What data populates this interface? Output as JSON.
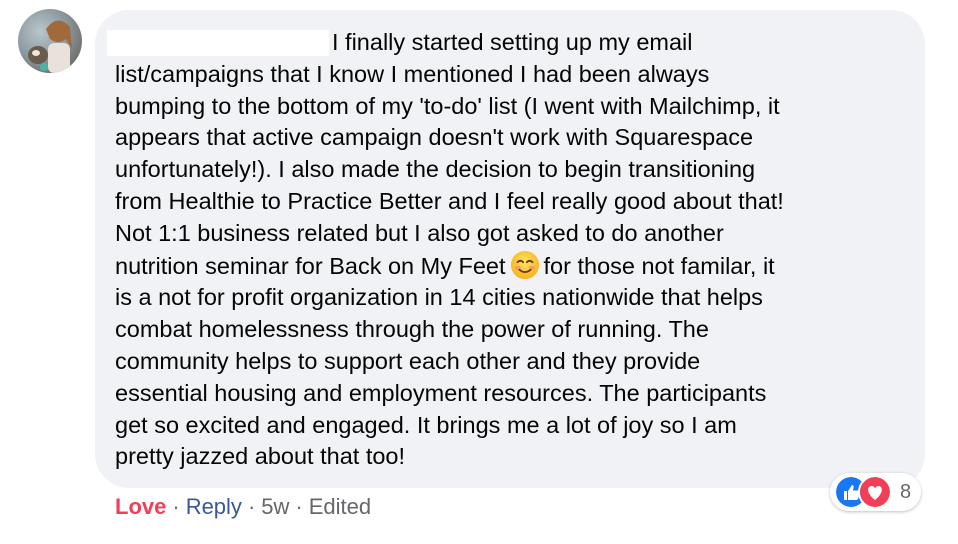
{
  "comment": {
    "lines_before_emoji": [
      "I finally started setting up my email",
      "list/campaigns that I know I mentioned I had been always",
      "bumping to the bottom of my 'to-do' list (I went with Mailchimp, it",
      "appears that active campaign doesn't work with Squarespace",
      "unfortunately!). I also made the decision to begin transitioning",
      "from Healthie to Practice Better and I feel really good about that!",
      "Not 1:1 business related but I also got asked to do another"
    ],
    "emoji_line_start": "nutrition seminar for Back on My Feet",
    "emoji_line_end": "for those not familar, it",
    "lines_after_emoji": [
      "is a not for profit organization in 14 cities nationwide that helps",
      "combat homelessness through the power of running. The",
      "community helps to support each other and they provide",
      "essential housing and employment resources. The participants",
      "get so excited and engaged. It brings me a lot of joy so I am",
      "pretty jazzed about that too!"
    ]
  },
  "reactions": {
    "icons": [
      "like-icon",
      "love-icon"
    ],
    "count": "8"
  },
  "actions": {
    "love_label": "Love",
    "reply_label": "Reply",
    "timestamp": "5w",
    "edited_label": "Edited",
    "separator": "·"
  },
  "colors": {
    "bubble_bg": "#f0f2f5",
    "love_red": "#f33e58",
    "reply_blue": "#385898",
    "like_blue": "#1877f2",
    "meta_gray": "#65676b"
  }
}
